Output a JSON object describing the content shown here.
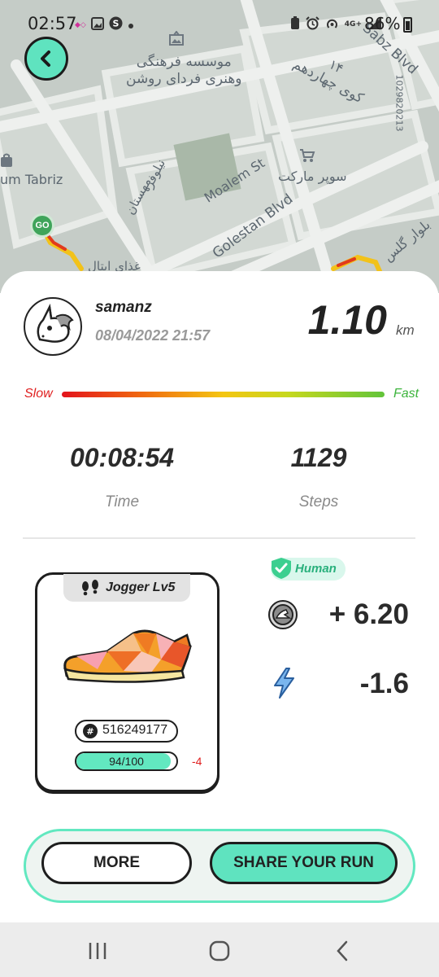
{
  "status_bar": {
    "time": "02:57",
    "battery": "86%",
    "left_icons": [
      "notification-app-icon",
      "gallery-icon",
      "s-app-icon",
      "dot-icon"
    ],
    "right_icons": [
      "battery-saver-icon",
      "alarm-icon",
      "hotspot-icon",
      "4g-signal-icon",
      "signal-icon",
      "battery-icon"
    ],
    "network_label": "4G+"
  },
  "map": {
    "labels": {
      "poi_cultural": "موسسه فرهنگی\nوهنری فردای روشن",
      "street_14": "کوی چهاردهم",
      "street_num": "۱۴",
      "sabz_blvd": "Sabz Blvd",
      "station_id": "1029820213",
      "museum": "um Tabriz",
      "niloufar": "نیلوفر",
      "mahestan": "مهستان",
      "moalem": "Moalem St",
      "supermarket": "سوپر مارکت",
      "golestan": "Golestan Blvd",
      "golestan_fa": "بلوار گلس",
      "food": "غذای ایتال"
    },
    "go_marker": "GO"
  },
  "run": {
    "username": "samanz",
    "datetime": "08/04/2022 21:57",
    "distance": "1.10",
    "distance_unit": "km",
    "speed_slow_label": "Slow",
    "speed_fast_label": "Fast",
    "time_value": "00:08:54",
    "time_label": "Time",
    "steps_value": "1129",
    "steps_label": "Steps"
  },
  "sneaker": {
    "level": "Jogger Lv5",
    "id": "516249177",
    "durability_text": "94/100",
    "durability_fraction": 0.94,
    "durability_delta": "-4"
  },
  "earnings": {
    "human_label": "Human",
    "gst_amount": "+ 6.20",
    "energy_amount": "-1.6"
  },
  "actions": {
    "more_label": "MORE",
    "share_label": "SHARE YOUR RUN"
  },
  "colors": {
    "accent_mint": "#5fe3bf",
    "human_green": "#29b07c",
    "negative_red": "#e02020"
  }
}
